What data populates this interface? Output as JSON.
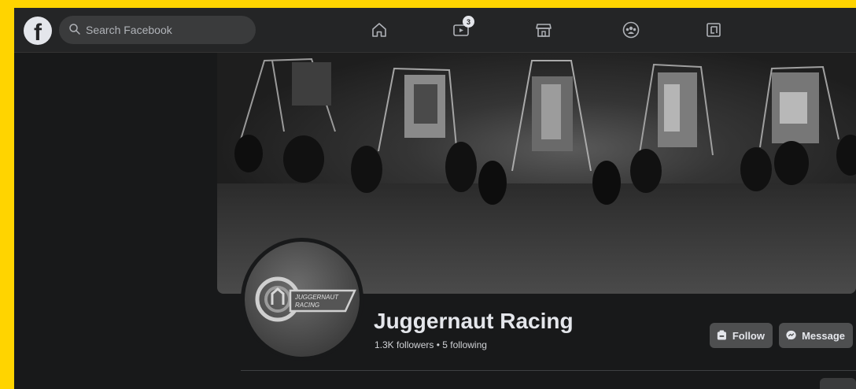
{
  "search": {
    "placeholder": "Search Facebook"
  },
  "nav": {
    "items": [
      {
        "name": "home",
        "icon": "home-icon"
      },
      {
        "name": "watch",
        "icon": "video-icon",
        "badge": "3"
      },
      {
        "name": "marketplace",
        "icon": "shop-icon"
      },
      {
        "name": "groups",
        "icon": "groups-icon"
      },
      {
        "name": "gaming",
        "icon": "gaming-icon"
      }
    ]
  },
  "profile": {
    "name": "Juggernaut Racing",
    "stats": "1.3K followers • 5 following",
    "logo_text": "JUGGERNAUT RACING"
  },
  "actions": {
    "follow_label": "Follow",
    "message_label": "Message"
  },
  "colors": {
    "frame": "#ffd400",
    "topbar": "#242526",
    "page_bg": "#18191a",
    "button": "#4e4f50",
    "text": "#e4e6eb"
  }
}
